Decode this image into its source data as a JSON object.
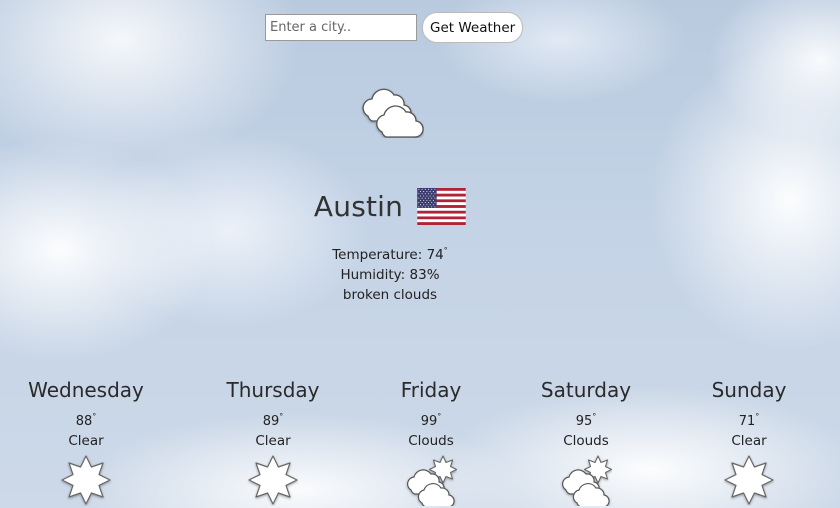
{
  "search": {
    "placeholder": "Enter a city..",
    "button_label": "Get Weather"
  },
  "current": {
    "icon": "cloudy-icon",
    "city": "Austin",
    "flag": "us-flag",
    "temperature_label": "Temperature: 74",
    "degree_symbol": "°",
    "humidity_label": "Humidity: 83%",
    "description": "broken clouds"
  },
  "forecast": [
    {
      "day": "Wednesday",
      "temp": "88",
      "condition": "Clear",
      "icon": "sun-icon"
    },
    {
      "day": "Thursday",
      "temp": "89",
      "condition": "Clear",
      "icon": "sun-icon"
    },
    {
      "day": "Friday",
      "temp": "99",
      "condition": "Clouds",
      "icon": "partly-cloudy-icon"
    },
    {
      "day": "Saturday",
      "temp": "95",
      "condition": "Clouds",
      "icon": "partly-cloudy-icon"
    },
    {
      "day": "Sunday",
      "temp": "71",
      "condition": "Clear",
      "icon": "sun-icon"
    }
  ],
  "colors": {
    "sky": "#c4d3e6",
    "text": "#222222",
    "flag_red": "#b22234",
    "flag_blue": "#3c3b6e"
  }
}
